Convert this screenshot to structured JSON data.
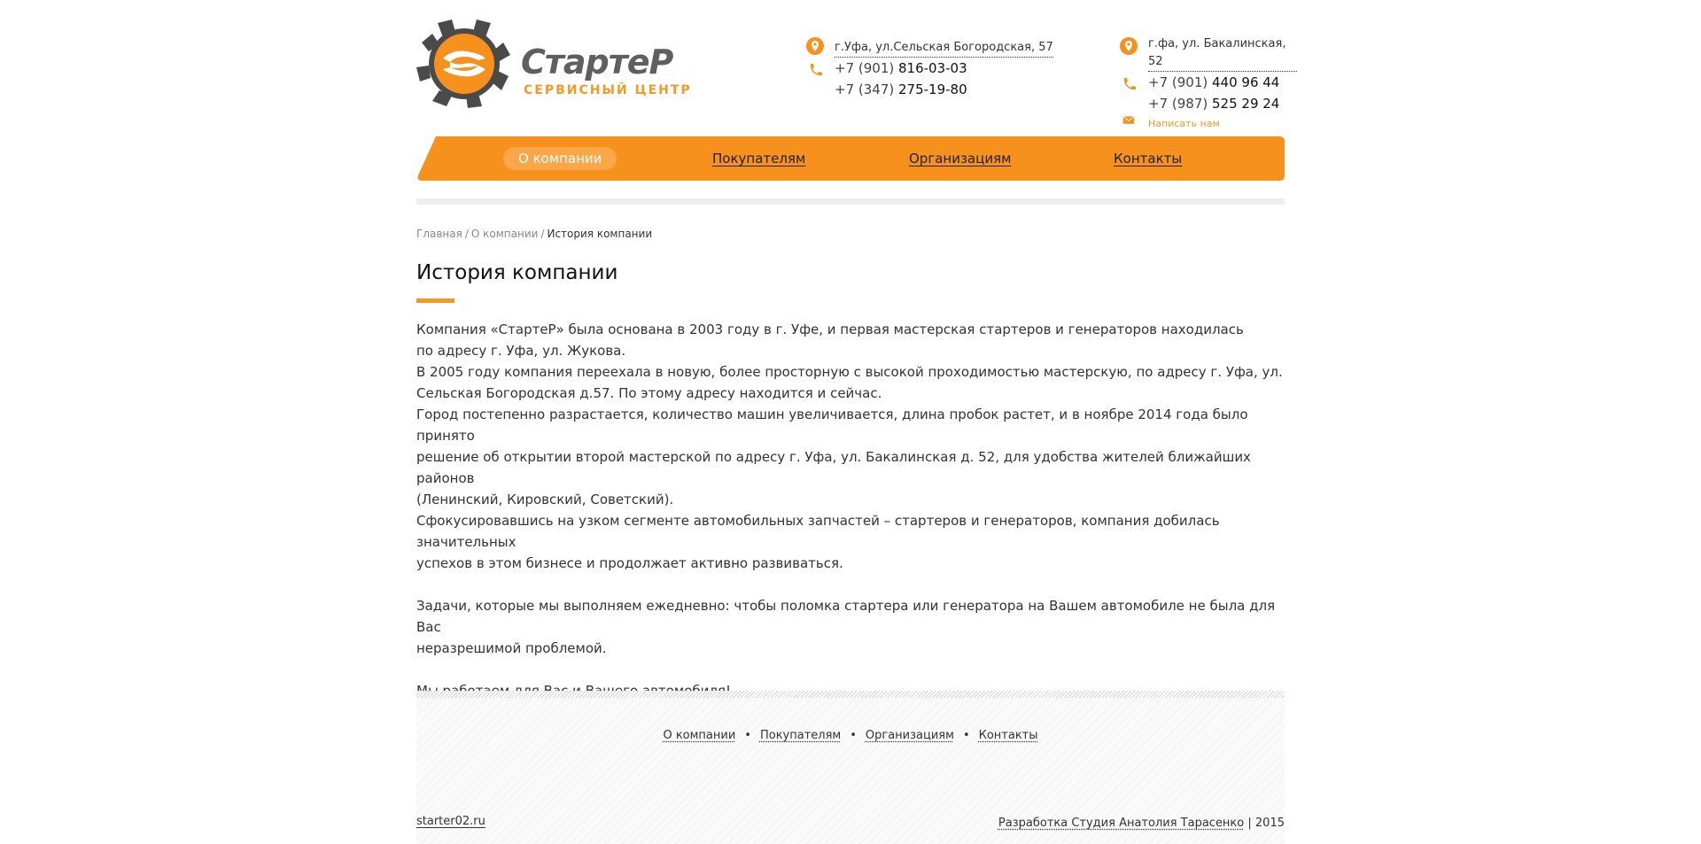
{
  "logo": {
    "name": "СтартеР",
    "subtitle": "СЕРВИСНЫЙ ЦЕНТР",
    "icon": "gear-s-icon"
  },
  "contacts": {
    "left": {
      "address": "г.Уфа, ул.Сельская Богородская, 57",
      "phones": [
        {
          "prefix": "+7 (901)",
          "number": "816-03-03"
        },
        {
          "prefix": "+7 (347)",
          "number": "275-19-80"
        }
      ]
    },
    "right": {
      "address": "г.фа, ул. Бакалинская, 52",
      "phones": [
        {
          "prefix": "+7 (901)",
          "number": "440 96 44"
        },
        {
          "prefix": "+7 (987)",
          "number": "525 29 24"
        }
      ],
      "mail_label": "Написать нам"
    }
  },
  "nav": {
    "items": [
      {
        "label": "О компании"
      },
      {
        "label": "Покупателям"
      },
      {
        "label": "Организациям"
      },
      {
        "label": "Контакты"
      }
    ]
  },
  "breadcrumb": {
    "home": "Главная",
    "sep": "/",
    "parent": "О компании",
    "current": "История компании"
  },
  "page": {
    "title": "История компании",
    "paragraphs": [
      "Компания «СтартеР» была основана в 2003 году в г. Уфе, и первая мастерская стартеров и генераторов находилась",
      "по адресу г. Уфа, ул. Жукова.",
      "В 2005 году компания переехала в новую, более просторную с высокой проходимостью мастерскую, по адресу г. Уфа,  ул.",
      "Сельская Богородская д.57. По этому адресу находится и сейчас.",
      "Город постепенно разрастается, количество машин увеличивается, длина пробок растет, и в ноябре 2014 года было принято",
      "решение об открытии второй мастерской по адресу г. Уфа, ул. Бакалинская д. 52, для удобства жителей ближайших районов",
      "(Ленинский, Кировский, Советский).",
      "Сфокусировавшись на узком сегменте автомобильных запчастей – стартеров и генераторов, компания добилась значительных",
      "успехов в этом бизнесе и продолжает активно развиваться.",
      "Задачи, которые мы выполняем ежедневно: чтобы поломка стартера или генератора на Вашем автомобиле не была для Вас",
      "неразрешимой проблемой.",
      "Мы работаем для Вас и Вашего автомобиля!"
    ]
  },
  "footer": {
    "nav": [
      "О компании",
      "Покупателям",
      "Организациям",
      "Контакты"
    ],
    "bullet": "•",
    "site": "starter02.ru",
    "dev_link": "Разработка Студия Анатолия Тарасенко",
    "dev_suffix": "| 2015"
  },
  "colors": {
    "accent": "#f7911e",
    "accent_light": "#fba648",
    "logo_gray": "#4a4a4a"
  }
}
